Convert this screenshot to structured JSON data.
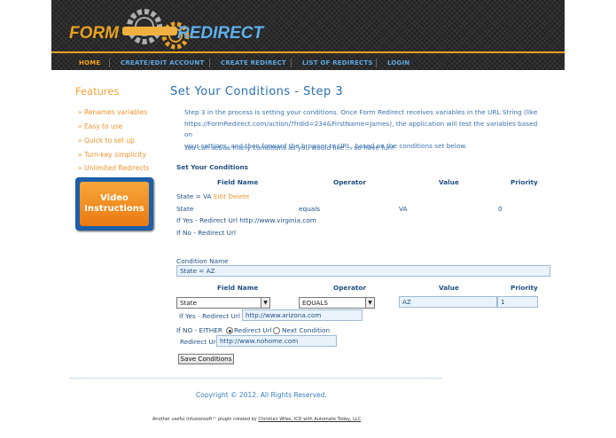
{
  "brand": {
    "logo_text_1": "FORM",
    "logo_text_2": "REDIRECT"
  },
  "nav": [
    "HOME",
    "CREATE/EDIT ACCOUNT",
    "CREATE REDIRECT",
    "LIST OF REDIRECTS",
    "LOGIN"
  ],
  "sidebar": {
    "title": "Features",
    "items": [
      "Renames variables",
      "Easy to use",
      "Quick to set up",
      "Turn-key simplicity",
      "Unlimited Redirects"
    ],
    "video": [
      "Video",
      "Instructions"
    ]
  },
  "main": {
    "title": "Set Your Conditions - Step 3",
    "intro_lines": [
      "Step 3 in the process is setting your conditions. Once Form Redirect receives variables in the URL String (like",
      "https://FormRedirect.com/action/?frdid=234&FirstName=James), the application will test the variables based on",
      "your settings, and then forward the browser to URL, based on the conditions set below."
    ],
    "intro2": "You can set as many conditions as you would like ... so have fun!",
    "section_title": "Set Your Conditions",
    "columns": [
      "Field Name",
      "Operator",
      "Value",
      "Priority"
    ],
    "existing": {
      "name": "State = VA",
      "edit": "Edit",
      "delete": "Delete",
      "field": "State",
      "operator": "equals",
      "value": "VA",
      "priority": "0",
      "if_yes": "If Yes - Redirect Url http://www.virginia.com",
      "if_no": "If No - Redirect Url"
    },
    "form": {
      "condition_name_label": "Condition Name",
      "condition_name_value": "State = AZ",
      "field_select": "State",
      "operator_select": "EQUALS",
      "value": "AZ",
      "priority": "1",
      "if_yes_label": "If Yes - Redirect Url",
      "if_yes_value": "http://www.arizona.com",
      "if_no_label": "If NO - EITHER",
      "radio_redirect": "Redirect Url",
      "radio_next": "Next Condition",
      "redirect_label": "Redirect Url",
      "redirect_value": "http://www.nohome.com",
      "save": "Save Conditions"
    }
  },
  "footer": {
    "copyright": "Copyright © 2012. All Rights Reserved.",
    "credit_prefix": "Another useful Infusionsoft™ plugin created by",
    "credit_link": "Christian Wiles, ICD with Automate Today, LLC"
  },
  "colors": {
    "accent": "#f0932b",
    "link_blue": "#2a6fb0",
    "header_bg": "#2b2b2b"
  }
}
